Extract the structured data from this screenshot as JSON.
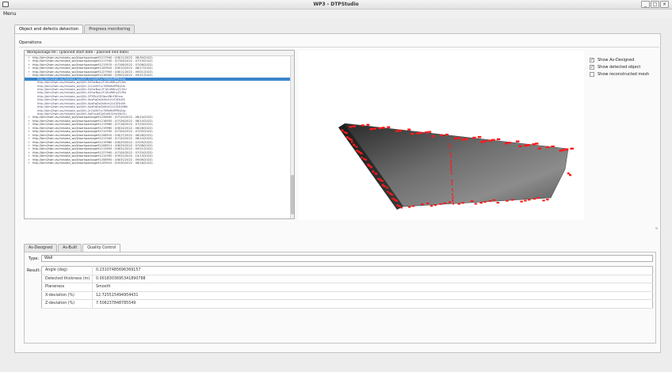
{
  "window": {
    "title": "WP3 - DTPStudio",
    "controls": [
      "_",
      "□",
      "×"
    ]
  },
  "menu": {
    "label": "Menu"
  },
  "tabs": [
    {
      "label": "Object and defects detection",
      "active": true
    },
    {
      "label": "Progress monitoring",
      "active": false
    }
  ],
  "operations": {
    "label": "Operations"
  },
  "workpackages": {
    "header": "Workpackage IRI : (planned start date - planned end date)",
    "rows": [
      {
        "text": "http://bim2twin.eu/mislata_wp3/workpackage91217940 : (08/11/2022 - 08/30/2022)",
        "level": 0,
        "expander": "+"
      },
      {
        "text": "http://bim2twin.eu/mislata_wp3/workpackage91217930 : (07/04/2022 - 07/19/2022)",
        "level": 0,
        "expander": "+"
      },
      {
        "text": "http://bim2twin.eu/mislata_wp3/workpackage91213970 : (07/06/2022 - 07/08/2022)",
        "level": 0,
        "expander": "+"
      },
      {
        "text": "http://bim2twin.eu/mislata_wp3/workpackage91209920 : (06/10/2022 - 06/17/2022)",
        "level": 0,
        "expander": "+"
      },
      {
        "text": "http://bim2twin.eu/mislata_wp3/workpackage91227950 : (08/11/2022 - 09/01/2022)",
        "level": 0,
        "expander": "+"
      },
      {
        "text": "http://bim2twin.eu/mislata_wp3/workpackage91218940 : (09/02/2022 - 09/21/2022)",
        "level": 0,
        "expander": "−"
      },
      {
        "text": "http://bim2twin.eu/mislata_wp3/ifc-2r2xN97ur76ReBdPP8tZzo",
        "level": 1,
        "selected": true
      },
      {
        "text": "http://bim2twin.eu/mislata_wp3/ifc-045wNqc2F18vW8hyZ1fes",
        "level": 1
      },
      {
        "text": "http://bim2twin.eu/mislata_wp3/ifc-2r2xN97ur76ReBdPP8tZzk",
        "level": 1
      },
      {
        "text": "http://bim2twin.eu/mislata_wp3/ifc-045wNqc2F18vW8hyZ1fVU",
        "level": 1
      },
      {
        "text": "http://bim2twin.eu/mislata_wp3/ifc-045wNqc2F18vW8hyZ1fPp",
        "level": 1
      },
      {
        "text": "http://bim2twin.eu/mislata_wp3/ifc-2P3RLt0D3bu4NhYRfmur",
        "level": 1
      },
      {
        "text": "http://bim2twin.eu/mislata_wp3/ifc-0psRqDo2b8ckQ1iCB3cBS",
        "level": 1
      },
      {
        "text": "http://bim2twin.eu/mislata_wp3/ifc-0psRqDo2b8ckQ1iCB3cBH",
        "level": 1
      },
      {
        "text": "http://bim2twin.eu/mislata_wp3/ifc-0psRqDo2b8ckQ1iCB3cBNB",
        "level": 1
      },
      {
        "text": "http://bim2twin.eu/mislata_wp3/ifc-2r2xN97ur76ReBdPP8tZzg",
        "level": 1
      },
      {
        "text": "http://bim2twin.eu/mislata_wp3/ifc-0qPucpSQe5b9LSj9x34kOu",
        "level": 1
      },
      {
        "text": "http://bim2twin.eu/mislata_wp3/workpackage91228940 : (07/20/2022 - 08/10/2022)",
        "level": 0,
        "expander": "+"
      },
      {
        "text": "http://bim2twin.eu/mislata_wp3/workpackage91218930 : (07/26/2022 - 08/10/2022)",
        "level": 0,
        "expander": "+"
      },
      {
        "text": "http://bim2twin.eu/mislata_wp3/workpackage91213960 : (07/18/2022 - 07/20/2022)",
        "level": 0,
        "expander": "+"
      },
      {
        "text": "http://bim2twin.eu/mislata_wp3/workpackage91219960 : (06/24/2022 - 06/28/2022)",
        "level": 0,
        "expander": "+"
      },
      {
        "text": "http://bim2twin.eu/mislata_wp3/workpackage91212930 : (07/04/2022 - 07/05/2022)",
        "level": 0,
        "expander": "+"
      },
      {
        "text": "http://bim2twin.eu/mislata_wp3/workpackage91208910 : (06/17/2022 - 06/28/2022)",
        "level": 0,
        "expander": "+"
      },
      {
        "text": "http://bim2twin.eu/mislata_wp3/workpackage91211940 : (07/20/2022 - 08/10/2022)",
        "level": 0,
        "expander": "+"
      },
      {
        "text": "http://bim2twin.eu/mislata_wp3/workpackage91219960 : (06/29/2022 - 07/05/2022)",
        "level": 0,
        "expander": "+"
      },
      {
        "text": "http://bim2twin.eu/mislata_wp3/workpackage91208911 : (06/29/2022 - 07/08/2022)",
        "level": 0,
        "expander": "+"
      },
      {
        "text": "http://bim2twin.eu/mislata_wp3/workpackage91213950 : (08/31/2022 - 09/21/2022)",
        "level": 0,
        "expander": "+"
      },
      {
        "text": "http://bim2twin.eu/mislata_wp3/workpackage91227940 : (07/04/2022 - 07/25/2022)",
        "level": 0,
        "expander": "+"
      },
      {
        "text": "http://bim2twin.eu/mislata_wp3/workpackage91212950 : (09/22/2022 - 10/13/2022)",
        "level": 0,
        "expander": "+"
      },
      {
        "text": "http://bim2twin.eu/mislata_wp3/workpackage91208950 : (08/31/2022 - 09/06/2022)",
        "level": 0,
        "expander": "+"
      },
      {
        "text": "http://bim2twin.eu/mislata_wp3/workpackage91209910 : (05/30/2022 - 06/16/2022)",
        "level": 0,
        "expander": "+"
      }
    ]
  },
  "viewer": {
    "surface_color": "#5a5a5a",
    "defect_color": "#ff1a1a"
  },
  "options": {
    "show_as_designed": {
      "label": "Show As-Designed",
      "checked": true
    },
    "show_detected": {
      "label": "Show detected object",
      "checked": true
    },
    "show_reconstructed": {
      "label": "Show reconstructed mesh",
      "checked": false
    }
  },
  "sub_tabs": [
    {
      "label": "As-Designed",
      "active": false
    },
    {
      "label": "As-Built",
      "active": false
    },
    {
      "label": "Quality Control",
      "active": true
    }
  ],
  "quality": {
    "type_label": "Type:",
    "type_value": "Wall",
    "result_label": "Result:",
    "results": [
      {
        "key": "Angle (deg)",
        "value": "0.23107485696369157"
      },
      {
        "key": "Detected thickness (m)",
        "value": "0.0018303695341890788"
      },
      {
        "key": "Planeness",
        "value": "Smooth"
      },
      {
        "key": "X-deviation (%)",
        "value": "12.725515494954431"
      },
      {
        "key": "Z-deviation (%)",
        "value": "7.506237848785549"
      }
    ]
  }
}
